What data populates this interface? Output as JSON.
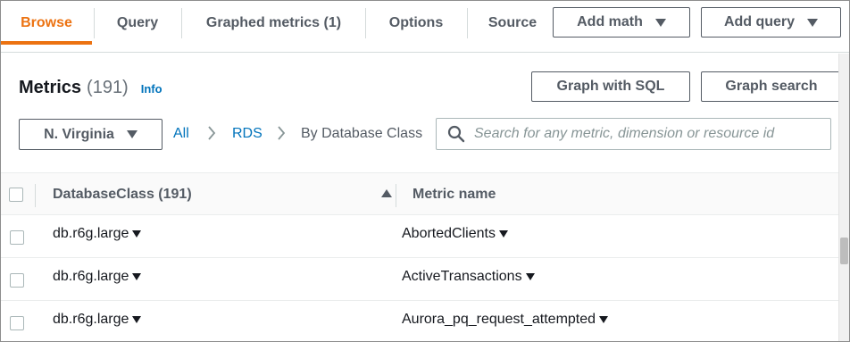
{
  "tabs": [
    {
      "label": "Browse",
      "active": true
    },
    {
      "label": "Query",
      "active": false
    },
    {
      "label": "Graphed metrics (1)",
      "active": false
    },
    {
      "label": "Options",
      "active": false
    },
    {
      "label": "Source",
      "active": false
    }
  ],
  "toolbar": {
    "add_math_label": "Add math",
    "add_query_label": "Add query",
    "graph_sql_label": "Graph with SQL",
    "graph_search_label": "Graph search"
  },
  "header": {
    "title": "Metrics",
    "count": "(191)",
    "info_link": "Info"
  },
  "filter": {
    "region": "N. Virginia",
    "breadcrumb": [
      "All",
      "RDS",
      "By Database Class"
    ],
    "search_placeholder": "Search for any metric, dimension or resource id",
    "search_value": ""
  },
  "table": {
    "columns": [
      "DatabaseClass (191)",
      "Metric name"
    ],
    "sort": {
      "column": "DatabaseClass (191)",
      "direction": "ascending"
    },
    "rows": [
      {
        "database_class": "db.r6g.large",
        "metric_name": "AbortedClients"
      },
      {
        "database_class": "db.r6g.large",
        "metric_name": "ActiveTransactions"
      },
      {
        "database_class": "db.r6g.large",
        "metric_name": "Aurora_pq_request_attempted"
      }
    ]
  },
  "colors": {
    "accent": "#ec7211",
    "link": "#0073bb",
    "text": "#16191f",
    "muted": "#545b64"
  },
  "icons": [
    "caret-down-icon",
    "chevron-right-icon",
    "search-icon",
    "sort-ascending-icon"
  ]
}
